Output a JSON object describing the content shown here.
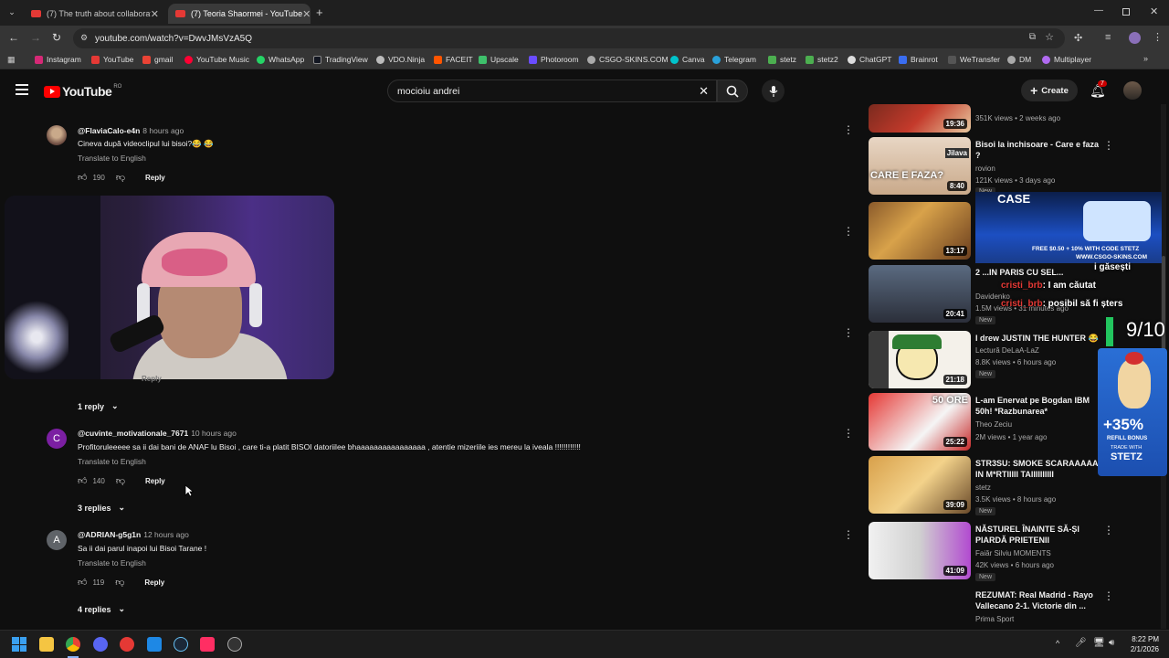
{
  "browser": {
    "tabs": [
      {
        "title": "(7) The truth about collaborati..."
      },
      {
        "title": "(7) Teoria Shaormei - YouTube"
      }
    ],
    "url": "youtube.com/watch?v=DwvJMsVzA5Q",
    "bookmarks": [
      "Instagram",
      "YouTube",
      "gmail",
      "YouTube Music",
      "WhatsApp",
      "TradingView",
      "VDO.Ninja",
      "FACEIT",
      "Upscale",
      "Photoroom",
      "CSGO-SKINS.COM",
      "Canva",
      "Telegram",
      "stetz",
      "stetz2",
      "ChatGPT",
      "Brainrot",
      "WeTransfer",
      "DM",
      "Multiplayer"
    ]
  },
  "youtube": {
    "logo_text": "YouTube",
    "country": "RO",
    "search_value": "mocioiu andrei",
    "create_label": "Create",
    "notif_count": "7"
  },
  "comments": [
    {
      "author": "@FlaviaCalo-e4n",
      "time": "8 hours ago",
      "text": "Cineva după videoclipul lui bisoi?😂 😂",
      "translate": "Translate to English",
      "likes": "190",
      "reply": "Reply",
      "avatar_color": "#8d6e63"
    },
    {
      "author": "@cuvinte_motivationale_7671",
      "time": "10 hours ago",
      "text": "Profitoruleeeee sa ii dai bani de ANAF lu Bisoi , care ti-a platit BISOI datoriilee bhaaaaaaaaaaaaaaaa , atentie mizeriile ies mereu la iveala !!!!!!!!!!!!",
      "translate": "Translate to English",
      "likes": "140",
      "reply": "Reply",
      "avatar_letter": "C",
      "avatar_color": "#7b1fa2"
    },
    {
      "author": "@ADRIAN-g5g1n",
      "time": "12 hours ago",
      "text": "Sa ii dai parul inapoi lui Bisoi  Tarane !",
      "translate": "Translate to English",
      "likes": "119",
      "reply": "Reply",
      "avatar_letter": "A",
      "avatar_color": "#5f6368"
    }
  ],
  "reply_toggles": [
    "1 reply",
    "3 replies",
    "4 replies"
  ],
  "hidden_reply_label": "Reply",
  "sidebar_videos": [
    {
      "title": "",
      "channel": "",
      "meta": "351K views • 2 weeks ago",
      "duration": "19:36"
    },
    {
      "title": "Bisoi la inchisoare - Care e faza ?",
      "channel": "rovion",
      "meta": "121K views • 3 days ago",
      "duration": "8:40",
      "badge": "New",
      "thumb_text": "CARE E FAZA?",
      "thumb_tag": "Jilava"
    },
    {
      "title": "",
      "channel": "",
      "meta": "",
      "duration": "13:17"
    },
    {
      "title": "2  ...IN PARIS CU SEL...",
      "channel": "Davidenko",
      "meta": "1.5M views • 31 minutes ago",
      "duration": "20:41",
      "badge": "New"
    },
    {
      "title": "I drew JUSTIN THE HUNTER 😂",
      "channel": "Lectură DeLaA-LaZ",
      "meta": "8.8K views • 6 hours ago",
      "duration": "21:18",
      "badge": "New"
    },
    {
      "title": "L-am Enervat pe Bogdan IBM 50h! *Razbunarea*",
      "channel": "Theo Zeciu",
      "meta": "2M views • 1 year ago",
      "duration": "25:22",
      "thumb_text": "50 ORE"
    },
    {
      "title": "STR3SU: SMOKE SCARAAAAA IN M*RTIIIII TAIIIIIIIIII",
      "channel": "stetz",
      "meta": "3.5K views • 8 hours ago",
      "duration": "39:09",
      "badge": "New"
    },
    {
      "title": "NĂSTUREL ÎNAINTE SĂ-ȘI PIARDĂ PRIETENII",
      "channel": "Faiăr Silviu MOMENTS",
      "meta": "42K views • 6 hours ago",
      "duration": "41:09",
      "badge": "New"
    },
    {
      "title": "REZUMAT: Real Madrid - Rayo Vallecano 2-1. Victorie din ...",
      "channel": "Prima Sport",
      "meta": "",
      "duration": ""
    }
  ],
  "overlays": {
    "promo": {
      "top": "CASE",
      "text": "FREE $0.50 + 10% WITH CODE STETZ",
      "site": "WWW.CSGO-SKINS.COM"
    },
    "chat": [
      {
        "user": "",
        "msg": "i găsești"
      },
      {
        "user": "cristi_brb",
        "msg": ": I am căutat"
      },
      {
        "user": "cristi_brb",
        "msg": ": posibil să fi șters"
      }
    ],
    "rating": "9/10",
    "ad": {
      "big": "+35%",
      "line1": "REFILL BONUS",
      "line2": "TRADE WITH",
      "line3": "STETZ"
    }
  },
  "taskbar": {
    "time": "8:22 PM",
    "date": "2/1/2026"
  },
  "colors": {
    "accent_red": "#ff0000",
    "link_gray": "#aaaaaa",
    "bg": "#0f0f0f"
  }
}
